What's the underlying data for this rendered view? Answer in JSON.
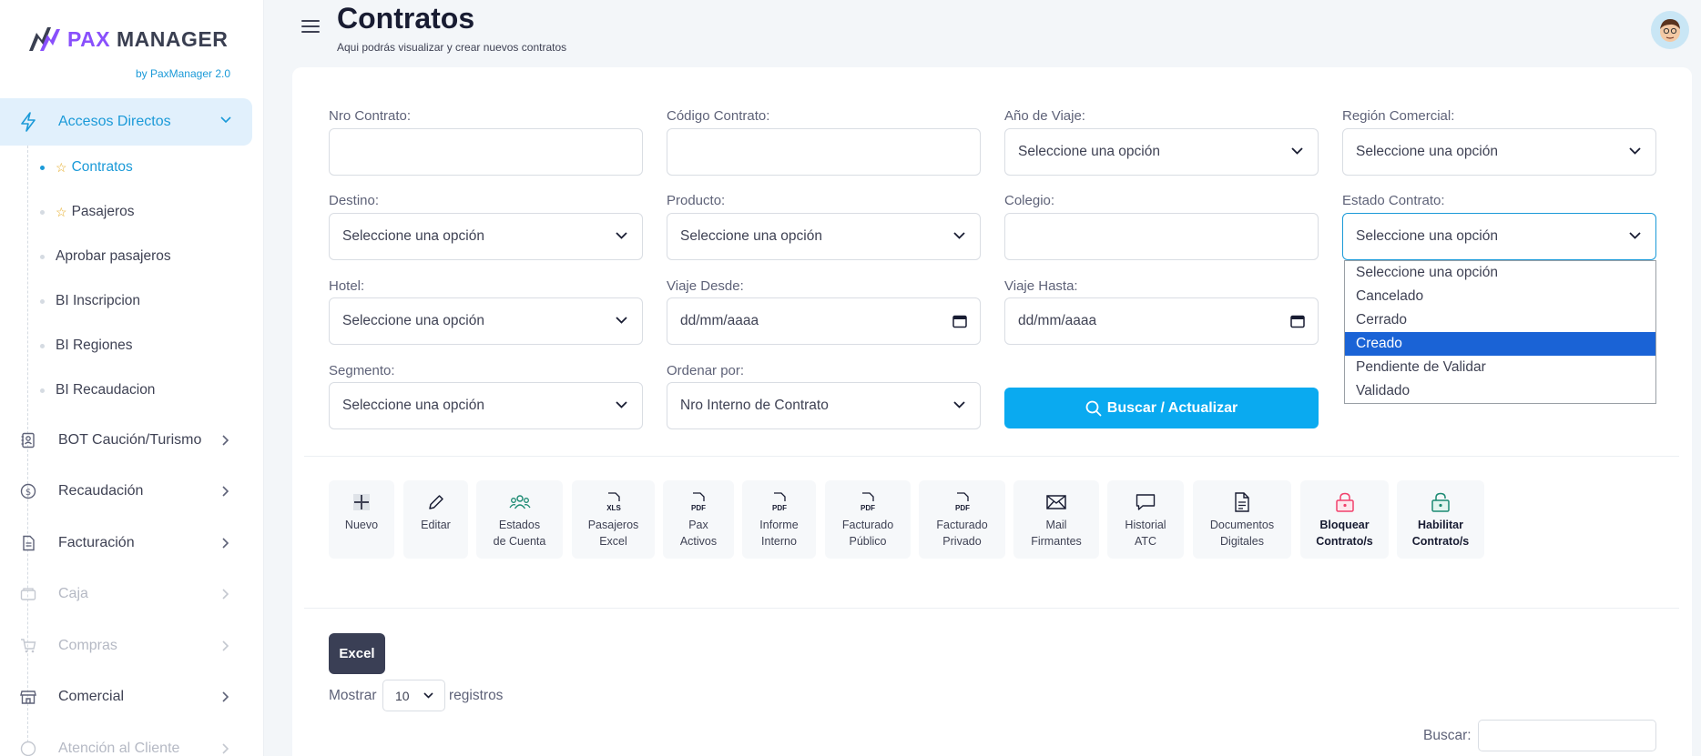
{
  "brand": {
    "pax": "PAX",
    "manager": "MANAGER",
    "sub": "by PaxManager 2.0"
  },
  "sidebar": {
    "active_section": "Accesos Directos",
    "sub_items": [
      {
        "label": "Contratos",
        "starred": true,
        "active": true
      },
      {
        "label": "Pasajeros",
        "starred": true,
        "active": false
      },
      {
        "label": "Aprobar pasajeros",
        "starred": false,
        "active": false
      },
      {
        "label": "BI Inscripcion",
        "starred": false,
        "active": false
      },
      {
        "label": "BI Regiones",
        "starred": false,
        "active": false
      },
      {
        "label": "BI Recaudacion",
        "starred": false,
        "active": false
      }
    ],
    "sections": [
      {
        "label": "BOT Caución/Turismo",
        "icon": "contacts-book-icon",
        "disabled": false
      },
      {
        "label": "Recaudación",
        "icon": "dollar-circle-icon",
        "disabled": false
      },
      {
        "label": "Facturación",
        "icon": "document-icon",
        "disabled": false
      },
      {
        "label": "Caja",
        "icon": "cash-box-icon",
        "disabled": true
      },
      {
        "label": "Compras",
        "icon": "cart-icon",
        "disabled": true
      },
      {
        "label": "Comercial",
        "icon": "store-icon",
        "disabled": false
      },
      {
        "label": "Atención al Cliente",
        "icon": "support-icon",
        "disabled": true
      }
    ]
  },
  "header": {
    "title": "Contratos",
    "subtitle": "Aqui podrás visualizar y crear nuevos contratos"
  },
  "filters": {
    "nro_contrato": {
      "label": "Nro Contrato:",
      "value": ""
    },
    "codigo_contrato": {
      "label": "Código Contrato:",
      "value": ""
    },
    "anio_viaje": {
      "label": "Año de Viaje:",
      "value": "Seleccione una opción"
    },
    "region_comercial": {
      "label": "Región Comercial:",
      "value": "Seleccione una opción"
    },
    "destino": {
      "label": "Destino:",
      "value": "Seleccione una opción"
    },
    "producto": {
      "label": "Producto:",
      "value": "Seleccione una opción"
    },
    "colegio": {
      "label": "Colegio:",
      "value": ""
    },
    "estado_contrato": {
      "label": "Estado Contrato:",
      "value": "Seleccione una opción"
    },
    "hotel": {
      "label": "Hotel:",
      "value": "Seleccione una opción"
    },
    "viaje_desde": {
      "label": "Viaje Desde:",
      "value": "dd/mm/aaaa"
    },
    "viaje_hasta": {
      "label": "Viaje Hasta:",
      "value": "dd/mm/aaaa"
    },
    "segmento": {
      "label": "Segmento:",
      "value": "Seleccione una opción"
    },
    "ordenar_por": {
      "label": "Ordenar por:",
      "value": "Nro Interno de Contrato"
    },
    "search_button": "Buscar / Actualizar"
  },
  "estado_dropdown": {
    "options": [
      "Seleccione una opción",
      "Cancelado",
      "Cerrado",
      "Creado",
      "Pendiente de Validar",
      "Validado"
    ],
    "highlighted": "Creado"
  },
  "toolbar": [
    {
      "label": "Nuevo",
      "icon": "plus-icon"
    },
    {
      "label": "Editar",
      "icon": "pencil-icon"
    },
    {
      "label": "Estados\nde Cuenta",
      "icon": "users-icon"
    },
    {
      "label": "Pasajeros\nExcel",
      "icon": "xls-file-icon"
    },
    {
      "label": "Pax\nActivos",
      "icon": "pdf-file-icon"
    },
    {
      "label": "Informe\nInterno",
      "icon": "pdf-file-icon"
    },
    {
      "label": "Facturado\nPúblico",
      "icon": "pdf-file-icon"
    },
    {
      "label": "Facturado\nPrivado",
      "icon": "pdf-file-icon"
    },
    {
      "label": "Mail\nFirmantes",
      "icon": "mail-icon"
    },
    {
      "label": "Historial\nATC",
      "icon": "chat-icon"
    },
    {
      "label": "Documentos\nDigitales",
      "icon": "document-icon"
    },
    {
      "label": "Bloquear\nContrato/s",
      "icon": "lock-icon"
    },
    {
      "label": "Habilitar\nContrato/s",
      "icon": "unlock-icon"
    }
  ],
  "file_tags": {
    "xls": "XLS",
    "pdf": "PDF"
  },
  "table_controls": {
    "excel_button": "Excel",
    "show_label": "Mostrar",
    "page_length": "10",
    "records_label": "registros",
    "search_label": "Buscar:"
  },
  "colors": {
    "accent": "#1b9ad8",
    "primary_button": "#0aaaf0",
    "brand_purple": "#8950fc",
    "lock_red": "#f1416c",
    "unlock_green": "#1b8a72"
  }
}
